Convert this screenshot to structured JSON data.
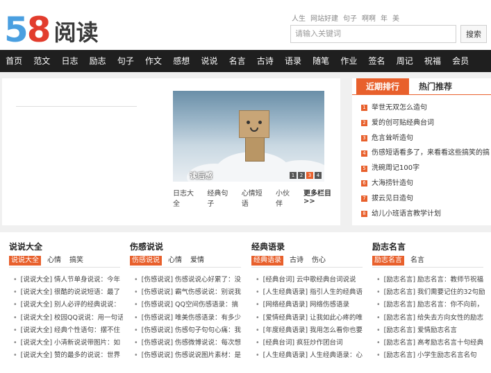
{
  "logo": {
    "digit1": "5",
    "digit2": "8",
    "name": "阅读"
  },
  "hot_words": [
    "人生",
    "网站好建",
    "句子",
    "啊啊",
    "年",
    "美"
  ],
  "search": {
    "placeholder": "请输入关键词",
    "button": "搜索"
  },
  "nav": [
    "首页",
    "范文",
    "日志",
    "励志",
    "句子",
    "作文",
    "感想",
    "说说",
    "名言",
    "古诗",
    "语录",
    "随笔",
    "作业",
    "签名",
    "周记",
    "祝福",
    "会员"
  ],
  "slide": {
    "caption": "读后感",
    "dots": [
      "1",
      "2",
      "3",
      "4"
    ],
    "active_dot": 3
  },
  "slide_links": [
    "日志大全",
    "经典句子",
    "心情短语",
    "小伙伴"
  ],
  "slide_more": "更多栏目>>",
  "rank": {
    "tabs": [
      "近期排行",
      "热门推荐"
    ],
    "items": [
      "举世无双怎么造句",
      "爱的创可贴经典台词",
      "危言耸听造句",
      "伤感短语看多了，来看看这些搞笑的搞个性",
      "洗碗周记100字",
      "大海捞针造句",
      "拔云见日造句",
      "幼儿小班语言教学计划"
    ]
  },
  "columns": [
    {
      "title": "说说大全",
      "tabs": [
        "说说大全",
        "心情",
        "搞笑"
      ],
      "items": [
        "[说说大全] 情人节单身说说：今年",
        "[说说大全] 很酷的说说短语：最了",
        "[说说大全] 别人必评的经典说说：",
        "[说说大全] 校园QQ说说：用一句话",
        "[说说大全] 经典个性语句：摆不住",
        "[说说大全] 小清新说说带图片：如",
        "[说说大全] 赞的最多的说说：世界"
      ]
    },
    {
      "title": "伤感说说",
      "tabs": [
        "伤感说说",
        "心情",
        "爱情"
      ],
      "items": [
        "[伤感说说] 伤感说说心好累了：没",
        "[伤感说说] 霸气伤感说说：别说我",
        "[伤感说说] QQ空间伤感语录：搞",
        "[伤感说说] 唯美伤感语录：有多少",
        "[伤感说说] 伤感句子句句心痛：我",
        "[伤感说说] 伤感微博说说：每次想",
        "[伤感说说] 伤感说说图片素材：是"
      ]
    },
    {
      "title": "经典语录",
      "tabs": [
        "经典语录",
        "古诗",
        "伤心"
      ],
      "items": [
        "[经典台词] 云中歌经典台词说说",
        "[人生经典语录] 指引人生的经典语",
        "[网络经典语录] 网络伤感语录",
        "[爱情经典语录] 让我如此心疼的唯",
        "[年度经典语录] 我用怎么看你也要",
        "[经典台词] 疯狂炒作团台词",
        "[人生经典语录] 人生经典语录：心"
      ]
    },
    {
      "title": "励志名言",
      "tabs": [
        "励志名言",
        "名言"
      ],
      "items": [
        "[励志名言] 励志名言：教师节祝福",
        "[励志名言] 我们需要记住的32句励",
        "[励志名言] 励志名言：你不向前，",
        "[励志名言] 给失去方向女性的励志",
        "[励志名言] 爱情励志名言",
        "[励志名言] 高考励志名言十句经典",
        "[励志名言] 小学生励志名言名句"
      ]
    }
  ]
}
